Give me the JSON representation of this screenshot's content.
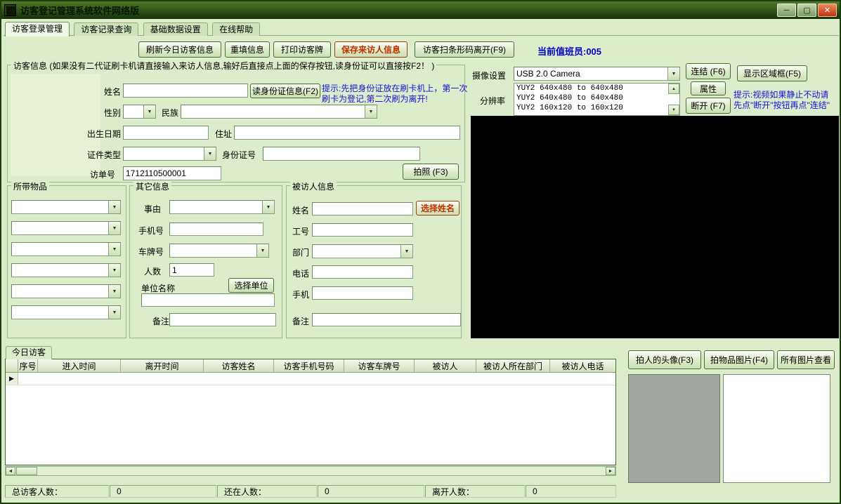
{
  "window": {
    "title": "访客登记管理系统软件网络版"
  },
  "icons": {
    "minimize": "─",
    "maximize": "▢",
    "close": "✕",
    "dropdown": "▼",
    "up": "▲",
    "down": "▼",
    "left": "◄",
    "right": "►",
    "row_marker": "▶"
  },
  "colors": {
    "accent_red": "#c03000",
    "hint_blue": "#1414dd",
    "operator_blue": "#0000cc",
    "titlebar_green": "#2f5214",
    "video_black": "#000000"
  },
  "menu_tabs": [
    {
      "label": "访客登录管理"
    },
    {
      "label": "访客记录查询"
    },
    {
      "label": "基础数据设置"
    },
    {
      "label": "在线帮助"
    }
  ],
  "toolbar": {
    "refresh_btn": "刷新今日访客信息",
    "refill_btn": "重填信息",
    "print_btn": "打印访客牌",
    "save_btn": "保存来访人信息",
    "scan_leave_btn": "访客扫条形码离开(F9)",
    "operator_label": "当前值班员:005"
  },
  "visitor": {
    "legend": "访客信息 (如果没有二代证刷卡机请直接输入来访人信息,输好后直接点上面的保存按钮,读身份证可以直接按F2！ )",
    "name": "姓名",
    "read_id_btn": "读身份证信息(F2)",
    "hint1": "提示:先把身份证放在刷卡机上，第一次",
    "hint2": "刷卡为登记,第二次刷为离开!",
    "gender": "性别",
    "nation": "民族",
    "birth": "出生日期",
    "address": "住址",
    "id_type": "证件类型",
    "id_no": "身份证号",
    "visit_no": "访单号",
    "visit_no_value": "1712110500001",
    "photo_btn": "拍照 (F3)"
  },
  "items": {
    "legend": "所带物品"
  },
  "other": {
    "legend": "其它信息",
    "reason": "事由",
    "mobile": "手机号",
    "plate": "车牌号",
    "people": "人数",
    "people_value": "1",
    "company": "单位名称",
    "select_company_btn": "选择单位",
    "remark": "备注"
  },
  "target": {
    "legend": "被访人信息",
    "name": "姓名",
    "select_name_btn": "选择姓名",
    "job_no": "工号",
    "dept": "部门",
    "phone": "电话",
    "mobile": "手机",
    "remark": "备注"
  },
  "camera": {
    "settings_label": "摄像设置",
    "device": "USB 2.0 Camera",
    "resolution_label": "分辨率",
    "resolutions": [
      "YUY2 640x480 to 640x480",
      "YUY2 640x480 to 640x480",
      "YUY2 160x120 to 160x120"
    ],
    "connect_btn": "连结 (F6)",
    "props_btn": "属性",
    "disconnect_btn": "断开 (F7)",
    "region_btn": "显示区域框(F5)",
    "hint1": "提示:视频如果静止不动请",
    "hint2": "先点\"断开\"按钮再点\"连结\""
  },
  "today": {
    "tab": "今日访客",
    "columns": [
      "序号",
      "进入时间",
      "离开时间",
      "访客姓名",
      "访客手机号码",
      "访客车牌号",
      "被访人",
      "被访人所在部门",
      "被访人电话"
    ]
  },
  "status": {
    "total_label": "总访客人数：",
    "total_value": "0",
    "present_label": "还在人数：",
    "present_value": "0",
    "left_label": "离开人数：",
    "left_value": "0"
  },
  "photos": {
    "head_btn": "拍人的头像(F3)",
    "item_btn": "拍物品图片(F4)",
    "view_btn": "所有图片查看"
  }
}
